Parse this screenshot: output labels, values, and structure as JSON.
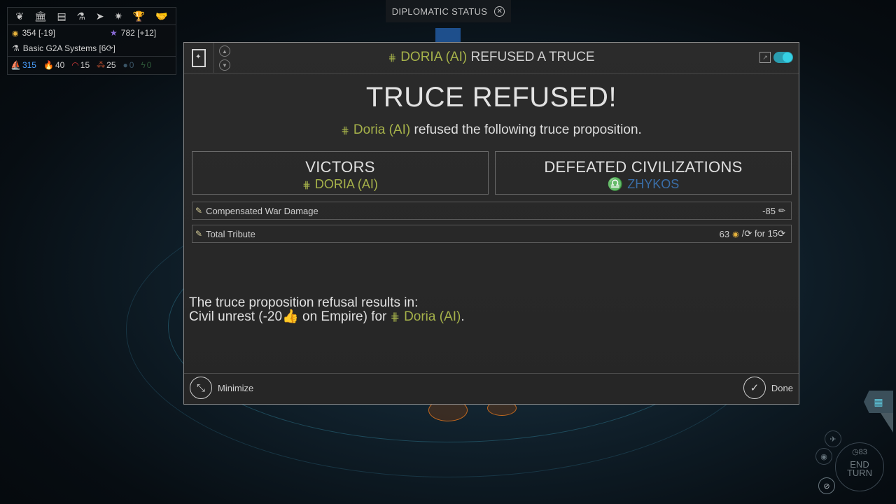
{
  "empire": {
    "gold": "354 [-19]",
    "influence": "782 [+12]",
    "tech": "Basic G2A Systems [6⟳]",
    "populations": [
      "315",
      "40",
      "15",
      "25",
      "0",
      "0"
    ]
  },
  "diplomatic_status": {
    "label": "DIPLOMATIC STATUS"
  },
  "dialog": {
    "title_faction": "DORIA (AI)",
    "title_rest": " REFUSED A TRUCE",
    "heading": "TRUCE REFUSED!",
    "subtitle_faction": "Doria (AI)",
    "subtitle_rest": " refused the following truce proposition.",
    "victors_label": "VICTORS",
    "victors_value": "DORIA (AI)",
    "defeated_label": "DEFEATED CIVILIZATIONS",
    "defeated_value": "ZHYKOS",
    "rows": [
      {
        "label": "Compensated War Damage",
        "value": "-85"
      },
      {
        "label": "Total Tribute",
        "value_a": "63",
        "value_b": "/⟳ for 15⟳"
      }
    ],
    "result_line1": "The truce proposition refusal results in:",
    "result_line2_a": "Civil unrest (-20",
    "result_line2_b": " on Empire) for ",
    "result_line2_faction": "Doria (AI)",
    "result_line2_end": ".",
    "minimize_label": "Minimize",
    "done_label": "Done"
  },
  "end_turn": {
    "turn": "83",
    "label_1": "END",
    "label_2": "TURN"
  },
  "colors": {
    "accent": "#38c3d6",
    "faction": "#a6b24a",
    "enemy": "#3a6ea8"
  }
}
